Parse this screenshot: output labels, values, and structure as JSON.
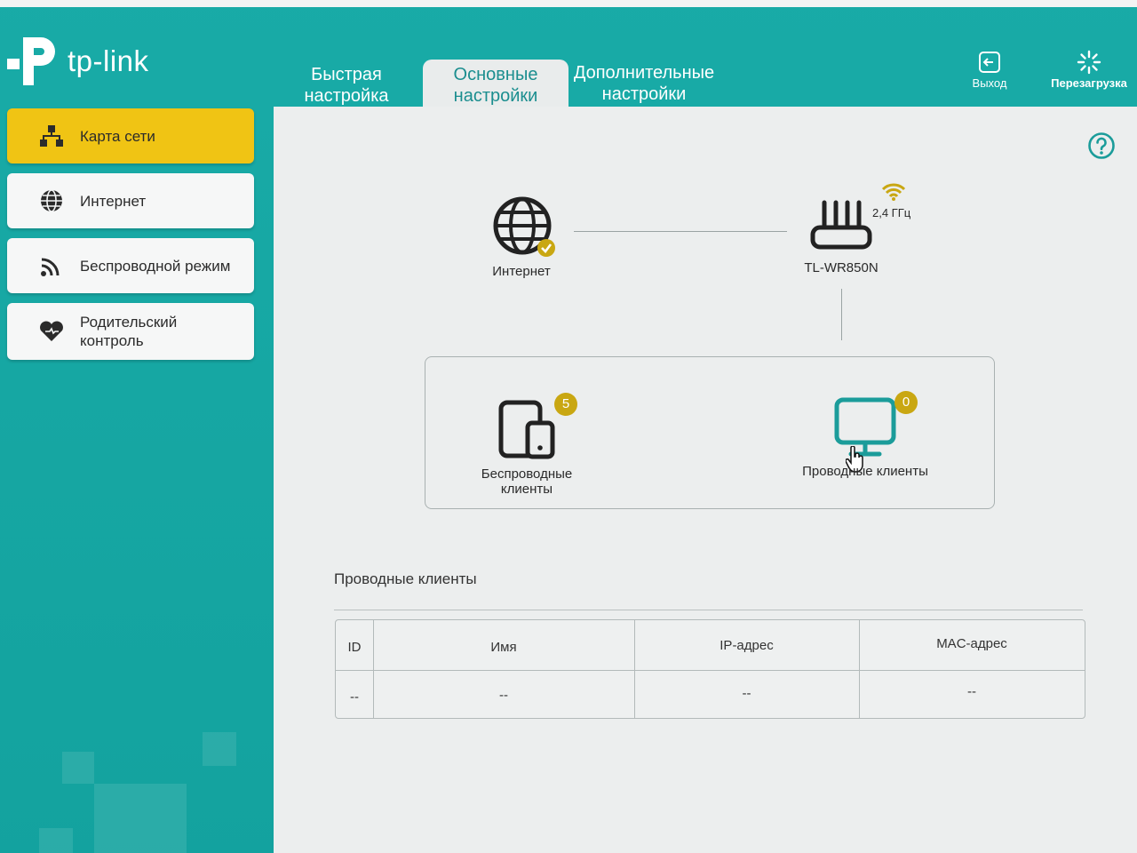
{
  "brand": {
    "logo_text": "tp-link"
  },
  "tabs": [
    {
      "line1": "Быстрая",
      "line2": "настройка"
    },
    {
      "line1": "Основные",
      "line2": "настройки"
    },
    {
      "line1": "Дополнительные",
      "line2": "настройки"
    }
  ],
  "actions": {
    "logout": "Выход",
    "reboot": "Перезагрузка"
  },
  "sidebar": {
    "items": [
      {
        "label": "Карта сети"
      },
      {
        "label": "Интернет"
      },
      {
        "label": "Беспроводной режим"
      },
      {
        "label_line1": "Родительский",
        "label_line2": "контроль"
      }
    ]
  },
  "network_map": {
    "internet_label": "Интернет",
    "router_label": "TL-WR850N",
    "band_label": "2,4 ГГц",
    "wireless_clients": {
      "label_line1": "Беспроводные",
      "label_line2": "клиенты",
      "count": "5"
    },
    "wired_clients": {
      "label": "Проводные клиенты",
      "count": "0"
    }
  },
  "clients_table": {
    "title": "Проводные клиенты",
    "headers": {
      "id": "ID",
      "name": "Имя",
      "ip": "IP-адрес",
      "mac": "MAC-адрес"
    },
    "row": {
      "id": "--",
      "name": "--",
      "ip": "--",
      "mac": "--"
    }
  },
  "colors": {
    "teal": "#14a9a5",
    "active_yellow": "#f0c414",
    "badge": "#c9a712",
    "accent_text": "#1b8e8f"
  },
  "icons": {
    "logout": "logout-icon",
    "reboot": "reboot-icon",
    "help": "help-icon",
    "network_map": "network-map-icon",
    "internet": "globe-icon",
    "wireless": "wireless-icon",
    "parental": "heart-icon",
    "router": "router-icon",
    "wifi": "wifi-icon",
    "devices": "devices-icon",
    "monitor": "monitor-icon",
    "cursor": "hand-cursor-icon"
  }
}
